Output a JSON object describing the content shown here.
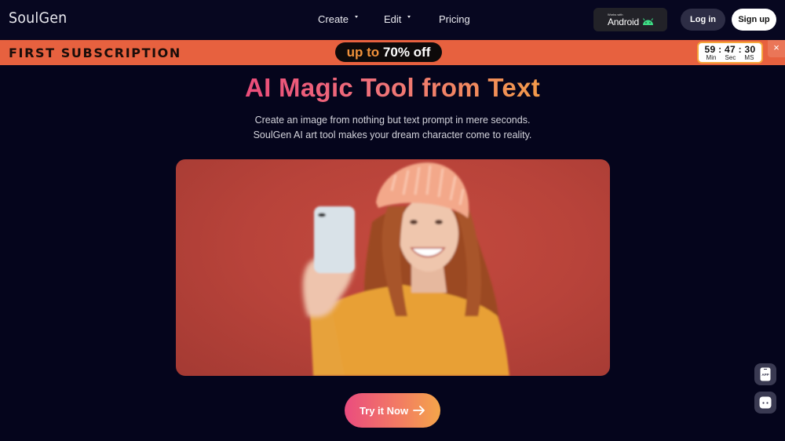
{
  "header": {
    "logo": "SoulGen",
    "nav": [
      {
        "label": "Create",
        "has_dropdown": true
      },
      {
        "label": "Edit",
        "has_dropdown": true
      },
      {
        "label": "Pricing",
        "has_dropdown": false
      }
    ],
    "android_badge": {
      "caption": "Works with",
      "name": "Android",
      "icon": "android-icon"
    },
    "login_label": "Log in",
    "signup_label": "Sign up"
  },
  "banner": {
    "title": "FIRST SUBSCRIPTION",
    "promo_prefix": "up to",
    "promo_value": "70% off",
    "timer": {
      "minutes": "59",
      "seconds": "47",
      "ms": "30",
      "separator": ":",
      "labels": [
        "Min",
        "Sec",
        "MS"
      ]
    },
    "close_icon": "×",
    "colors": {
      "background": "#e7613f",
      "pill": "#0d0a0a",
      "accent": "#f0923b"
    }
  },
  "hero": {
    "title": "AI Magic Tool from Text",
    "subtitle_lines": [
      "Create an image from nothing but text prompt in mere seconds.",
      "SoulGen AI art tool makes your dream character come to reality."
    ],
    "image_alt": "Woman with curly red hair in an orange sweater and knit beanie taking a selfie against a red background",
    "cta_label": "Try it Now",
    "cta_icon": "arrow-right-icon",
    "gradient": [
      "#ea4c7a",
      "#f39a4a"
    ]
  },
  "side_buttons": [
    {
      "icon": "app-download-icon",
      "label": "APP"
    },
    {
      "icon": "chat-bot-icon"
    }
  ]
}
